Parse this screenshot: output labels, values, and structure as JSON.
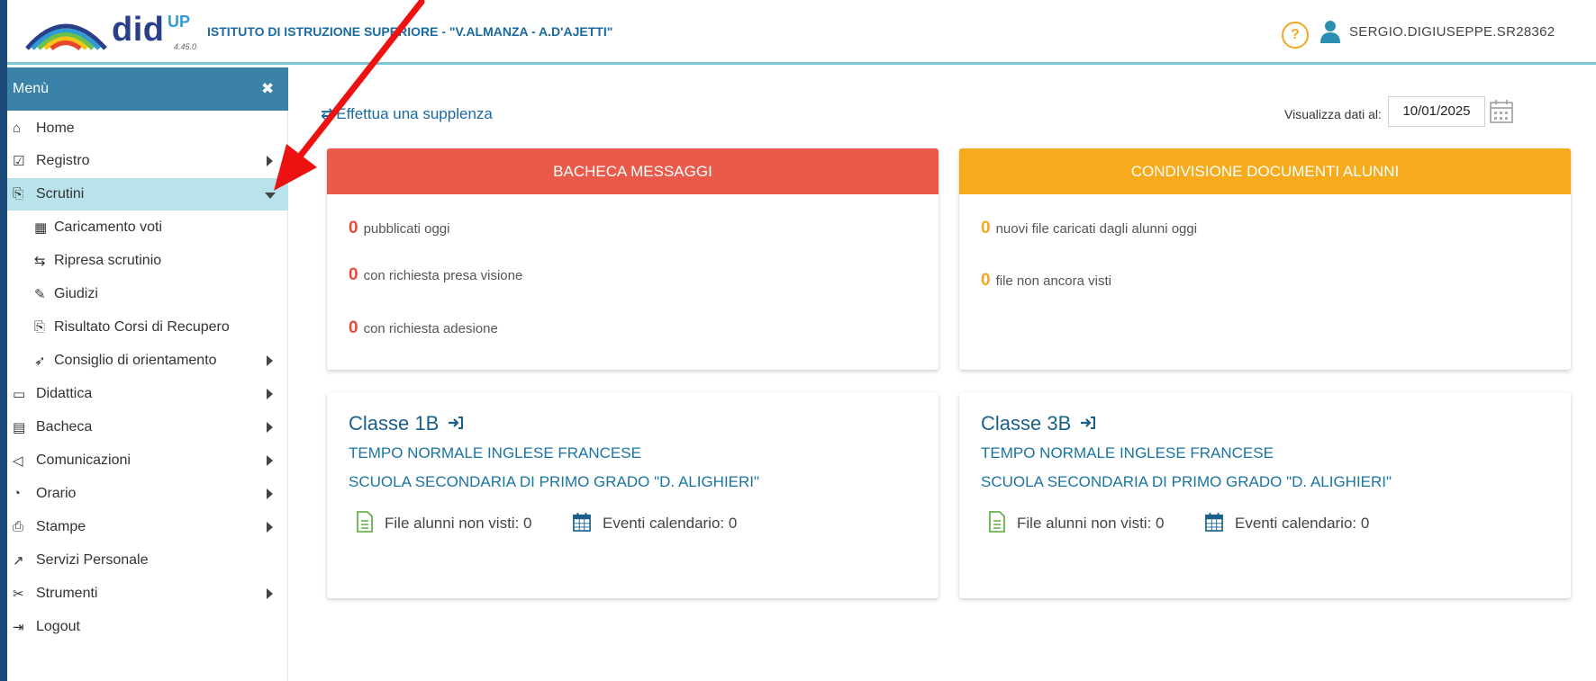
{
  "header": {
    "logo_word": "did",
    "logo_up": "UP",
    "version": "4.45.0",
    "school_name": "ISTITUTO DI ISTRUZIONE SUPERIORE - \"V.ALMANZA - A.D'AJETTI\"",
    "help_label": "?",
    "user_name": "SERGIO.DIGIUSEPPE.SR28362"
  },
  "sidebar": {
    "title": "Menù",
    "close_label": "✖",
    "items": [
      {
        "label": "Home",
        "icon": "⌂",
        "icon_name": "home-icon"
      },
      {
        "label": "Registro",
        "icon": "☑",
        "icon_name": "calendar-check-icon"
      },
      {
        "label": "Scrutini",
        "icon": "⎘",
        "icon_name": "scrutini-icon"
      },
      {
        "label": "Caricamento voti",
        "icon": "▦",
        "icon_name": "qr-grid-icon"
      },
      {
        "label": "Ripresa scrutinio",
        "icon": "⇆",
        "icon_name": "swap-icon"
      },
      {
        "label": "Giudizi",
        "icon": "✎",
        "icon_name": "edit-icon"
      },
      {
        "label": "Risultato Corsi di Recupero",
        "icon": "⎘",
        "icon_name": "document-icon"
      },
      {
        "label": "Consiglio di orientamento",
        "icon": "➶",
        "icon_name": "brush-icon"
      },
      {
        "label": "Didattica",
        "icon": "▭",
        "icon_name": "book-icon"
      },
      {
        "label": "Bacheca",
        "icon": "▤",
        "icon_name": "newspaper-icon"
      },
      {
        "label": "Comunicazioni",
        "icon": "◁",
        "icon_name": "megaphone-icon"
      },
      {
        "label": "Orario",
        "icon": "◔",
        "icon_name": "clock-icon"
      },
      {
        "label": "Stampe",
        "icon": "⎙",
        "icon_name": "printer-icon"
      },
      {
        "label": "Servizi Personale",
        "icon": "↗",
        "icon_name": "share-icon"
      },
      {
        "label": "Strumenti",
        "icon": "✂",
        "icon_name": "tools-icon"
      },
      {
        "label": "Logout",
        "icon": "⇥",
        "icon_name": "logout-icon"
      }
    ]
  },
  "main": {
    "supplenza_label": "Effettua una supplenza",
    "date_label": "Visualizza dati al:",
    "date_value": "10/01/2025",
    "bacheca": {
      "title": "BACHECA MESSAGGI",
      "stats": [
        {
          "num": "0",
          "text": "pubblicati oggi"
        },
        {
          "num": "0",
          "text": "con richiesta presa visione"
        },
        {
          "num": "0",
          "text": "con richiesta adesione"
        }
      ]
    },
    "condivisione": {
      "title": "CONDIVISIONE DOCUMENTI ALUNNI",
      "stats": [
        {
          "num": "0",
          "text": "nuovi file caricati dagli alunni oggi"
        },
        {
          "num": "0",
          "text": "file non ancora visti"
        }
      ]
    },
    "classes": [
      {
        "title": "Classe 1B",
        "line1": "TEMPO NORMALE INGLESE FRANCESE",
        "line2": "SCUOLA SECONDARIA DI PRIMO GRADO \"D. ALIGHIERI\"",
        "files": "File alunni non visti: 0",
        "events": "Eventi calendario: 0"
      },
      {
        "title": "Classe 3B",
        "line1": "TEMPO NORMALE INGLESE FRANCESE",
        "line2": "SCUOLA SECONDARIA DI PRIMO GRADO \"D. ALIGHIERI\"",
        "files": "File alunni non visti: 0",
        "events": "Eventi calendario: 0"
      }
    ]
  },
  "colors": {
    "bacheca_header": "#e95a4a",
    "condivisione_header": "#f7ab1c",
    "menu_header": "#3b82a8",
    "active_item": "#b9e3ea",
    "stat_red": "#e44b3c",
    "stat_orange": "#f5a623",
    "annotation_arrow": "#ee1111"
  }
}
